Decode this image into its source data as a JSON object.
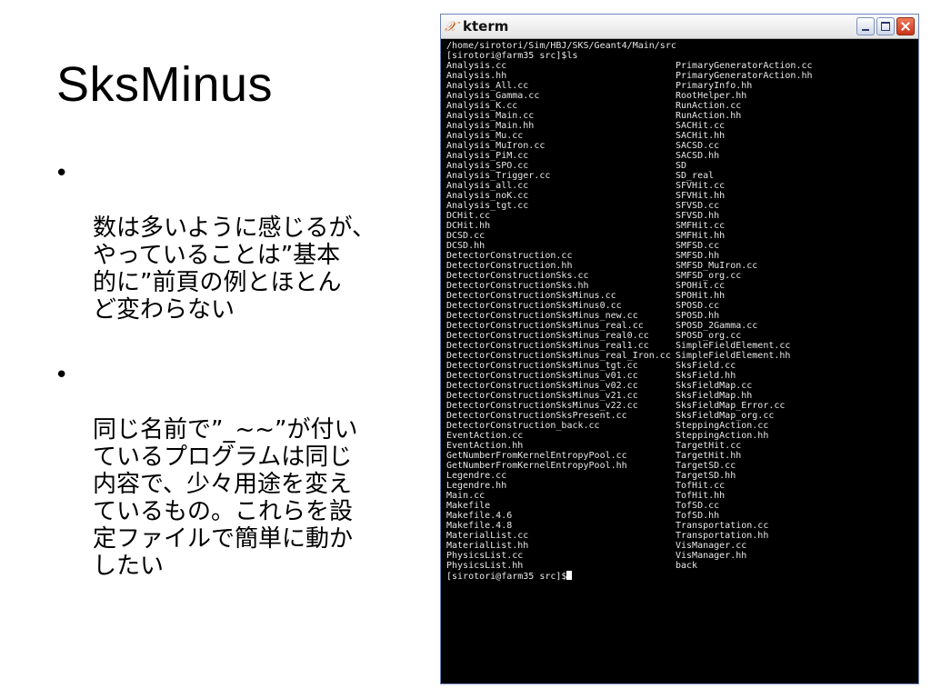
{
  "slide": {
    "title": "SksMinus",
    "bullets": [
      {
        "dot": "•",
        "text": "数は多いように感じるが、\nやっていることは”基本\n的に”前頁の例とほとん\nど変わらない"
      },
      {
        "dot": "•",
        "text": "同じ名前で”_~~”が付い\nているプログラムは同じ\n内容で、少々用途を変え\nているもの。これらを設\n定ファイルで簡単に動か\nしたい"
      }
    ]
  },
  "window": {
    "icon": "x-window-icon",
    "title": "kterm",
    "colors": {
      "background": "#000000",
      "text": "#e8e8e8",
      "close": "#d9462a"
    }
  },
  "terminal": {
    "cwd_line": "/home/sirotori/Sim/HBJ/SKS/Geant4/Main/src",
    "command_line": "[sirotori@farm35 src]$ls",
    "files_left": [
      "Analysis.cc",
      "Analysis.hh",
      "Analysis_All.cc",
      "Analysis_Gamma.cc",
      "Analysis_K.cc",
      "Analysis_Main.cc",
      "Analysis_Main.hh",
      "Analysis_Mu.cc",
      "Analysis_MuIron.cc",
      "Analysis_PiM.cc",
      "Analysis_SPO.cc",
      "Analysis_Trigger.cc",
      "Analysis_all.cc",
      "Analysis_noK.cc",
      "Analysis_tgt.cc",
      "DCHit.cc",
      "DCHit.hh",
      "DCSD.cc",
      "DCSD.hh",
      "DetectorConstruction.cc",
      "DetectorConstruction.hh",
      "DetectorConstructionSks.cc",
      "DetectorConstructionSks.hh",
      "DetectorConstructionSksMinus.cc",
      "DetectorConstructionSksMinus0.cc",
      "DetectorConstructionSksMinus_new.cc",
      "DetectorConstructionSksMinus_real.cc",
      "DetectorConstructionSksMinus_real0.cc",
      "DetectorConstructionSksMinus_real1.cc",
      "DetectorConstructionSksMinus_real_Iron.cc",
      "DetectorConstructionSksMinus_tgt.cc",
      "DetectorConstructionSksMinus_v01.cc",
      "DetectorConstructionSksMinus_v02.cc",
      "DetectorConstructionSksMinus_v21.cc",
      "DetectorConstructionSksMinus_v22.cc",
      "DetectorConstructionSksPresent.cc",
      "DetectorConstruction_back.cc",
      "EventAction.cc",
      "EventAction.hh",
      "GetNumberFromKernelEntropyPool.cc",
      "GetNumberFromKernelEntropyPool.hh",
      "Legendre.cc",
      "Legendre.hh",
      "Main.cc",
      "Makefile",
      "Makefile.4.6",
      "Makefile.4.8",
      "MaterialList.cc",
      "MaterialList.hh",
      "PhysicsList.cc",
      "PhysicsList.hh"
    ],
    "files_right": [
      "PrimaryGeneratorAction.cc",
      "PrimaryGeneratorAction.hh",
      "PrimaryInfo.hh",
      "RootHelper.hh",
      "RunAction.cc",
      "RunAction.hh",
      "SACHit.cc",
      "SACHit.hh",
      "SACSD.cc",
      "SACSD.hh",
      "SD",
      "SD_real",
      "SFVHit.cc",
      "SFVHit.hh",
      "SFVSD.cc",
      "SFVSD.hh",
      "SMFHit.cc",
      "SMFHit.hh",
      "SMFSD.cc",
      "SMFSD.hh",
      "SMFSD_MuIron.cc",
      "SMFSD_org.cc",
      "SPOHit.cc",
      "SPOHit.hh",
      "SPOSD.cc",
      "SPOSD.hh",
      "SPOSD_2Gamma.cc",
      "SPOSD_org.cc",
      "SimpleFieldElement.cc",
      "SimpleFieldElement.hh",
      "SksField.cc",
      "SksField.hh",
      "SksFieldMap.cc",
      "SksFieldMap.hh",
      "SksFieldMap_Error.cc",
      "SksFieldMap_org.cc",
      "SteppingAction.cc",
      "SteppingAction.hh",
      "TargetHit.cc",
      "TargetHit.hh",
      "TargetSD.cc",
      "TargetSD.hh",
      "TofHit.cc",
      "TofHit.hh",
      "TofSD.cc",
      "TofSD.hh",
      "Transportation.cc",
      "Transportation.hh",
      "VisManager.cc",
      "VisManager.hh",
      "back"
    ],
    "prompt": "[sirotori@farm35 src]$"
  }
}
